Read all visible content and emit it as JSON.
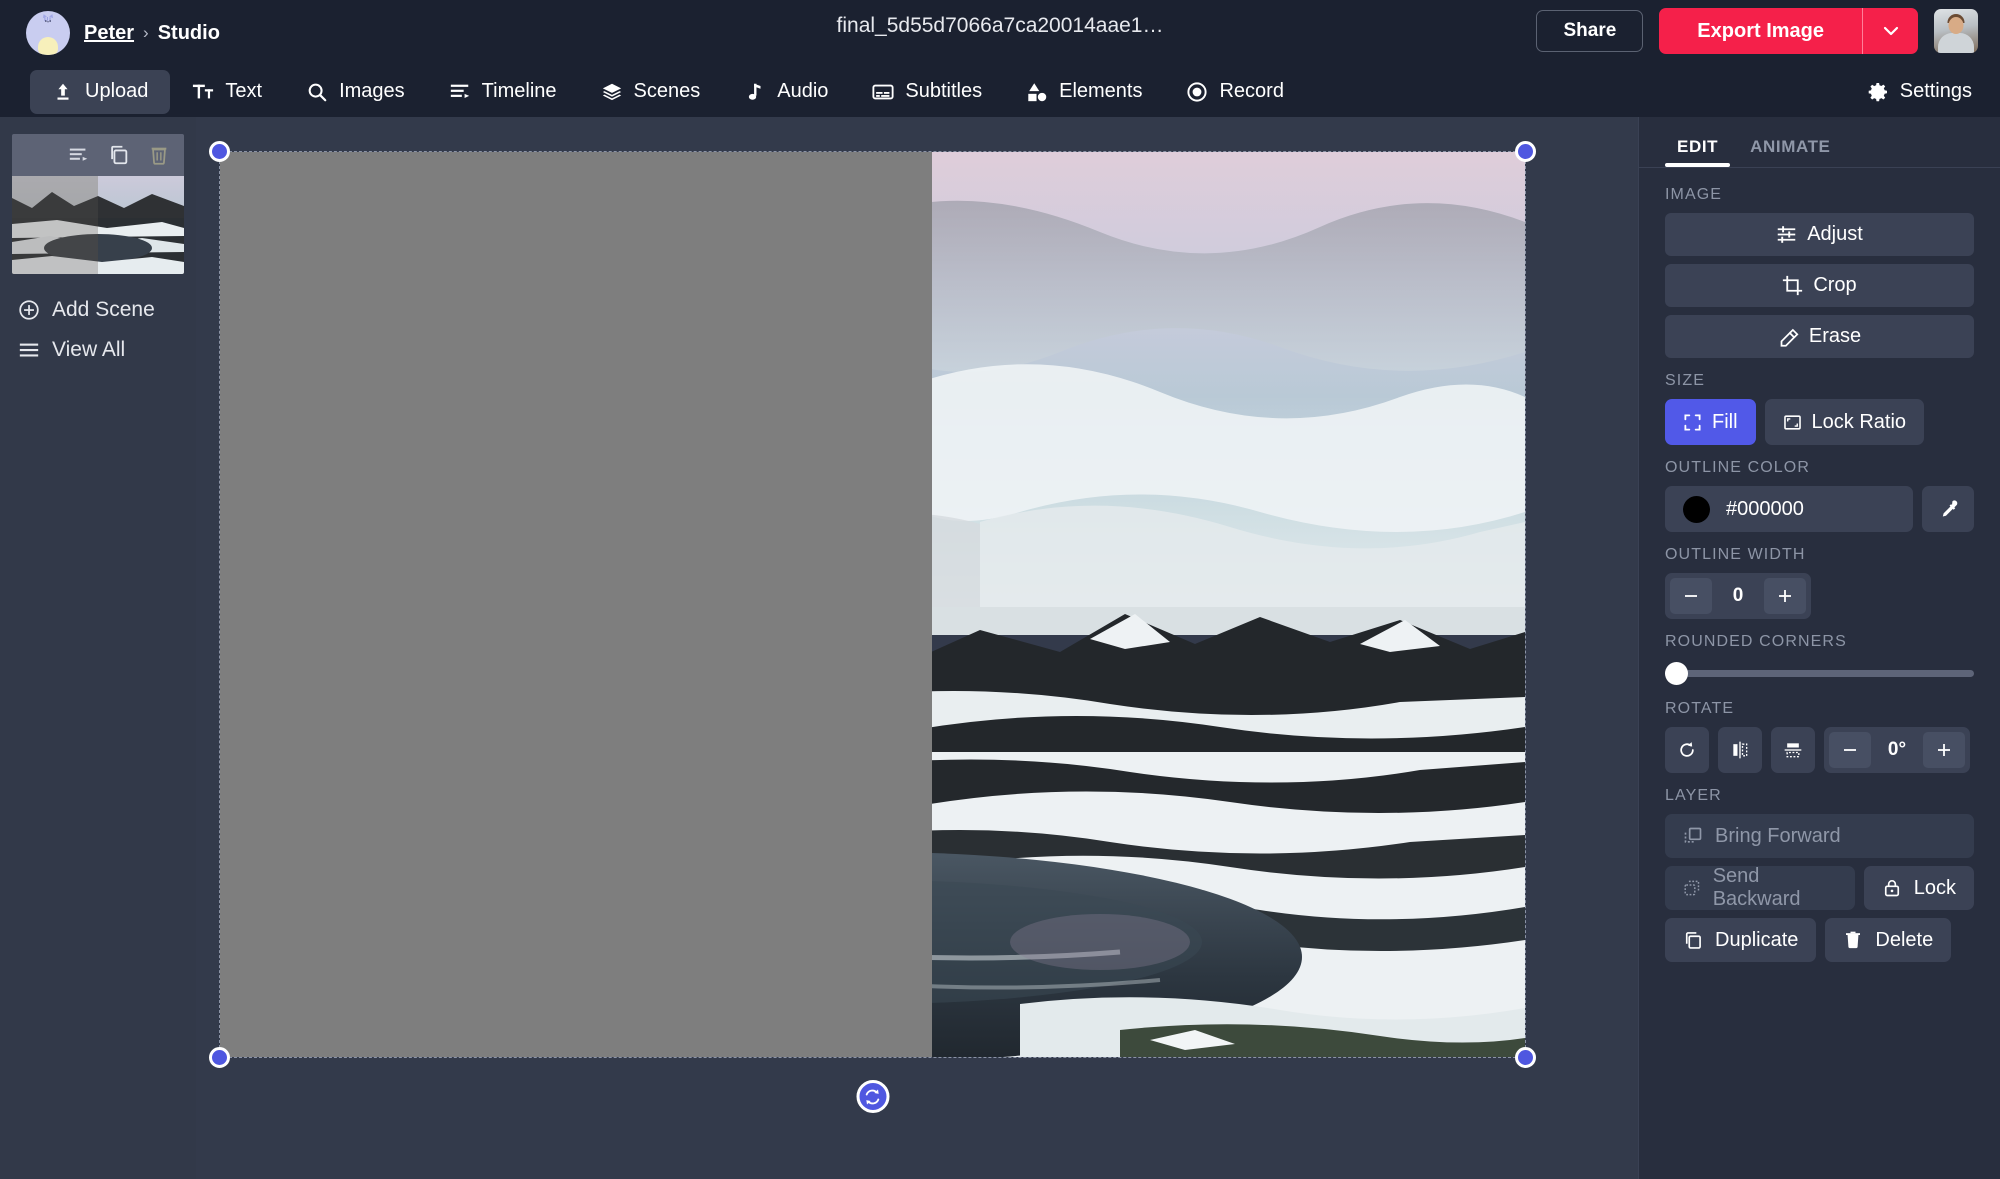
{
  "header": {
    "breadcrumb_user": "Peter",
    "breadcrumb_sep": "›",
    "breadcrumb_current": "Studio",
    "doc_title": "final_5d55d7066a7ca20014aae1…",
    "share_label": "Share",
    "export_label": "Export Image",
    "export_caret_icon": "chevron-down-icon",
    "avatar_icon": "cat-avatar",
    "user_photo_icon": "user-avatar",
    "accent_color": "#f5204a"
  },
  "nav": {
    "items": [
      {
        "label": "Upload",
        "icon": "upload-icon",
        "active": true
      },
      {
        "label": "Text",
        "icon": "text-icon",
        "active": false
      },
      {
        "label": "Images",
        "icon": "search-icon",
        "active": false
      },
      {
        "label": "Timeline",
        "icon": "timeline-icon",
        "active": false
      },
      {
        "label": "Scenes",
        "icon": "layers-icon",
        "active": false
      },
      {
        "label": "Audio",
        "icon": "music-note-icon",
        "active": false
      },
      {
        "label": "Subtitles",
        "icon": "subtitles-icon",
        "active": false
      },
      {
        "label": "Elements",
        "icon": "shapes-icon",
        "active": false
      },
      {
        "label": "Record",
        "icon": "record-icon",
        "active": false
      }
    ],
    "settings_label": "Settings",
    "settings_icon": "gear-icon"
  },
  "sidebar": {
    "scene_toolbar": [
      "timeline-icon",
      "duplicate-icon",
      "trash-icon"
    ],
    "actions": [
      {
        "label": "Add Scene",
        "icon": "plus-circle-icon"
      },
      {
        "label": "View All",
        "icon": "list-icon"
      }
    ]
  },
  "canvas": {
    "handles": [
      "top-left",
      "top-right",
      "bottom-left",
      "bottom-right"
    ],
    "rotate_icon": "rotate-icon",
    "handle_color": "#4f57e0"
  },
  "panel": {
    "tabs": [
      {
        "label": "EDIT",
        "active": true
      },
      {
        "label": "ANIMATE",
        "active": false
      }
    ],
    "image_section": {
      "label": "IMAGE",
      "buttons": [
        {
          "label": "Adjust",
          "icon": "sliders-icon"
        },
        {
          "label": "Crop",
          "icon": "crop-icon"
        },
        {
          "label": "Erase",
          "icon": "eraser-icon"
        }
      ]
    },
    "size_section": {
      "label": "SIZE",
      "fill_label": "Fill",
      "fill_icon": "expand-icon",
      "fill_selected": true,
      "lock_ratio_label": "Lock Ratio",
      "lock_ratio_icon": "aspect-ratio-icon"
    },
    "outline_color_section": {
      "label": "OUTLINE COLOR",
      "value": "#000000",
      "swatch_color": "#000000",
      "eyedropper_icon": "eyedropper-icon"
    },
    "outline_width_section": {
      "label": "OUTLINE WIDTH",
      "value": "0",
      "minus_icon": "minus-icon",
      "plus_icon": "plus-icon"
    },
    "rounded_corners_section": {
      "label": "ROUNDED CORNERS",
      "value": 0
    },
    "rotate_section": {
      "label": "ROTATE",
      "value": "0°",
      "rotate_icon": "rotate-cw-icon",
      "flip_h_icon": "flip-horizontal-icon",
      "flip_v_icon": "flip-vertical-icon",
      "minus_icon": "minus-icon",
      "plus_icon": "plus-icon"
    },
    "layer_section": {
      "label": "LAYER",
      "bring_forward": {
        "label": "Bring Forward",
        "icon": "bring-forward-icon",
        "enabled": false
      },
      "send_backward": {
        "label": "Send Backward",
        "icon": "send-backward-icon",
        "enabled": false
      },
      "lock": {
        "label": "Lock",
        "icon": "lock-icon",
        "enabled": true
      },
      "duplicate": {
        "label": "Duplicate",
        "icon": "duplicate-icon",
        "enabled": true
      },
      "delete": {
        "label": "Delete",
        "icon": "trash-icon",
        "enabled": true
      }
    }
  }
}
